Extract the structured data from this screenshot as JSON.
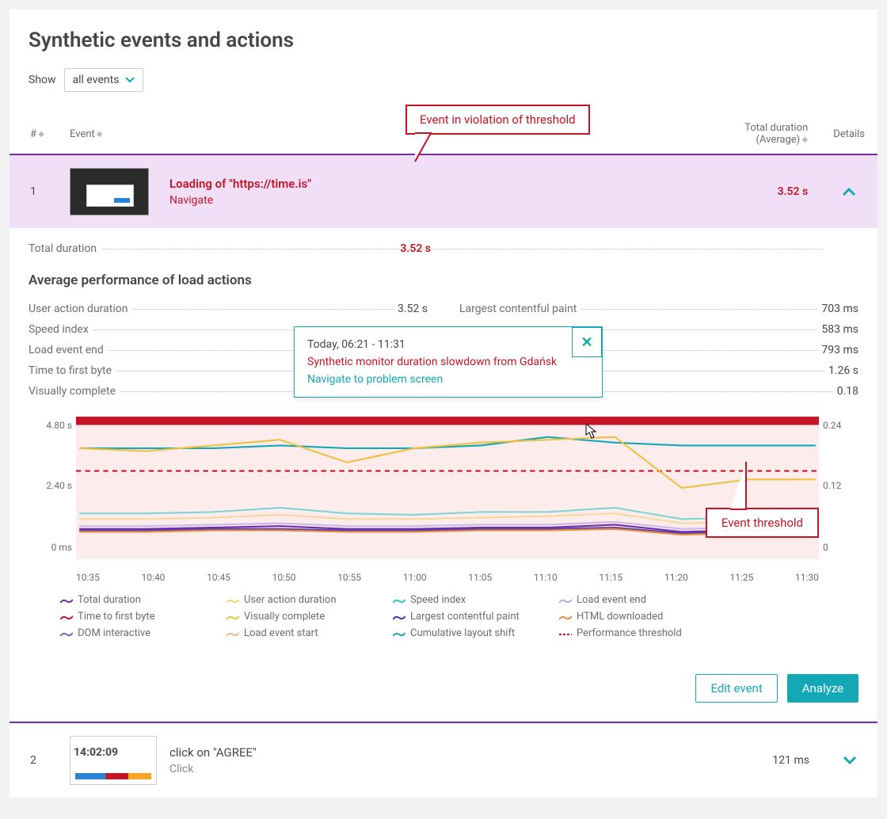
{
  "page": {
    "title": "Synthetic events and actions"
  },
  "filter": {
    "label": "Show",
    "value": "all events"
  },
  "callout_violation": "Event in violation of threshold",
  "callout_threshold": "Event threshold",
  "columns": {
    "num": "#",
    "event": "Event",
    "duration": "Total duration (Average)",
    "details": "Details"
  },
  "row1": {
    "num": "1",
    "title": "Loading of \"https://time.is\"",
    "subtitle": "Navigate",
    "duration": "3.52 s"
  },
  "total_duration": {
    "label": "Total duration",
    "value": "3.52 s"
  },
  "perf_title": "Average performance of load actions",
  "metrics_left": [
    {
      "k": "User action duration",
      "v": "3.52 s"
    },
    {
      "k": "Speed index",
      "v": ""
    },
    {
      "k": "Load event end",
      "v": ""
    },
    {
      "k": "Time to first byte",
      "v": ""
    },
    {
      "k": "Visually complete",
      "v": ""
    }
  ],
  "metrics_right": [
    {
      "k": "Largest contentful paint",
      "v": "703 ms"
    },
    {
      "k": "",
      "v": "583 ms"
    },
    {
      "k": "",
      "v": "793 ms"
    },
    {
      "k": "",
      "v": "1.26 s"
    },
    {
      "k": "",
      "v": "0.18"
    }
  ],
  "popover": {
    "time": "Today, 06:21 - 11:31",
    "msg": "Synthetic monitor duration slowdown from Gdańsk",
    "link": "Navigate to problem screen"
  },
  "yleft": [
    "4.80 s",
    "2.40 s",
    "0 ms"
  ],
  "yright": [
    "0.24",
    "0.12",
    "0"
  ],
  "xaxis": [
    "10:35",
    "10:40",
    "10:45",
    "10:50",
    "10:55",
    "11:00",
    "11:05",
    "11:10",
    "11:15",
    "11:20",
    "11:25",
    "11:30"
  ],
  "legend": [
    {
      "c": "#6f2da8",
      "t": "Total duration"
    },
    {
      "c": "#f5d580",
      "t": "User action duration"
    },
    {
      "c": "#2ec4c4",
      "t": "Speed index"
    },
    {
      "c": "#b8a6e6",
      "t": "Load event end"
    },
    {
      "c": "#c41425",
      "t": "Time to first byte"
    },
    {
      "c": "#f0c040",
      "t": "Visually complete"
    },
    {
      "c": "#4a2da8",
      "t": "Largest contentful paint"
    },
    {
      "c": "#e88a3a",
      "t": "HTML downloaded"
    },
    {
      "c": "#7a5fc4",
      "t": "DOM interactive"
    },
    {
      "c": "#f5b590",
      "t": "Load event start"
    },
    {
      "c": "#14a8b6",
      "t": "Cumulative layout shift"
    },
    {
      "c": "#c41425",
      "t": "Performance threshold",
      "dash": true
    }
  ],
  "buttons": {
    "edit": "Edit event",
    "analyze": "Analyze"
  },
  "row2": {
    "num": "2",
    "title": "click on \"AGREE\"",
    "subtitle": "Click",
    "clock": "14:02:09",
    "duration": "121 ms"
  },
  "chart_data": {
    "type": "line",
    "x": [
      "10:35",
      "10:40",
      "10:45",
      "10:50",
      "10:55",
      "11:00",
      "11:05",
      "11:10",
      "11:15",
      "11:20",
      "11:25",
      "11:30"
    ],
    "yleft_range": [
      0,
      4.8
    ],
    "yright_range": [
      0,
      0.24
    ],
    "threshold": 3.0,
    "series": [
      {
        "name": "Cumulative layout shift",
        "axis": "right",
        "values": [
          0.19,
          0.19,
          0.19,
          0.195,
          0.19,
          0.19,
          0.195,
          0.21,
          0.2,
          0.195,
          0.195,
          0.195
        ]
      },
      {
        "name": "Visually complete",
        "axis": "left",
        "values": [
          3.8,
          3.7,
          3.9,
          4.1,
          3.3,
          3.8,
          4.0,
          4.1,
          4.2,
          2.4,
          2.7,
          2.7
        ]
      },
      {
        "name": "Speed index",
        "axis": "left",
        "values": [
          1.5,
          1.5,
          1.55,
          1.7,
          1.5,
          1.45,
          1.55,
          1.55,
          1.7,
          1.3,
          1.35,
          1.35
        ]
      },
      {
        "name": "User action duration",
        "axis": "left",
        "values": [
          1.3,
          1.3,
          1.35,
          1.45,
          1.3,
          1.3,
          1.35,
          1.4,
          1.5,
          1.15,
          1.2,
          1.2
        ]
      },
      {
        "name": "Load event end",
        "axis": "left",
        "values": [
          1.05,
          1.05,
          1.1,
          1.15,
          1.05,
          1.05,
          1.1,
          1.1,
          1.2,
          0.95,
          1.0,
          1.0
        ]
      },
      {
        "name": "Total duration",
        "axis": "left",
        "values": [
          0.95,
          0.95,
          1.0,
          1.05,
          0.95,
          0.95,
          1.0,
          1.0,
          1.1,
          0.85,
          0.9,
          0.9
        ]
      },
      {
        "name": "Largest contentful paint",
        "axis": "left",
        "values": [
          0.9,
          0.9,
          0.95,
          0.95,
          0.9,
          0.9,
          0.95,
          0.95,
          1.0,
          0.8,
          0.85,
          0.85
        ]
      },
      {
        "name": "HTML downloaded",
        "axis": "left",
        "values": [
          0.85,
          0.85,
          0.9,
          0.9,
          0.85,
          0.85,
          0.9,
          0.9,
          0.95,
          0.75,
          0.8,
          0.8
        ]
      }
    ]
  }
}
